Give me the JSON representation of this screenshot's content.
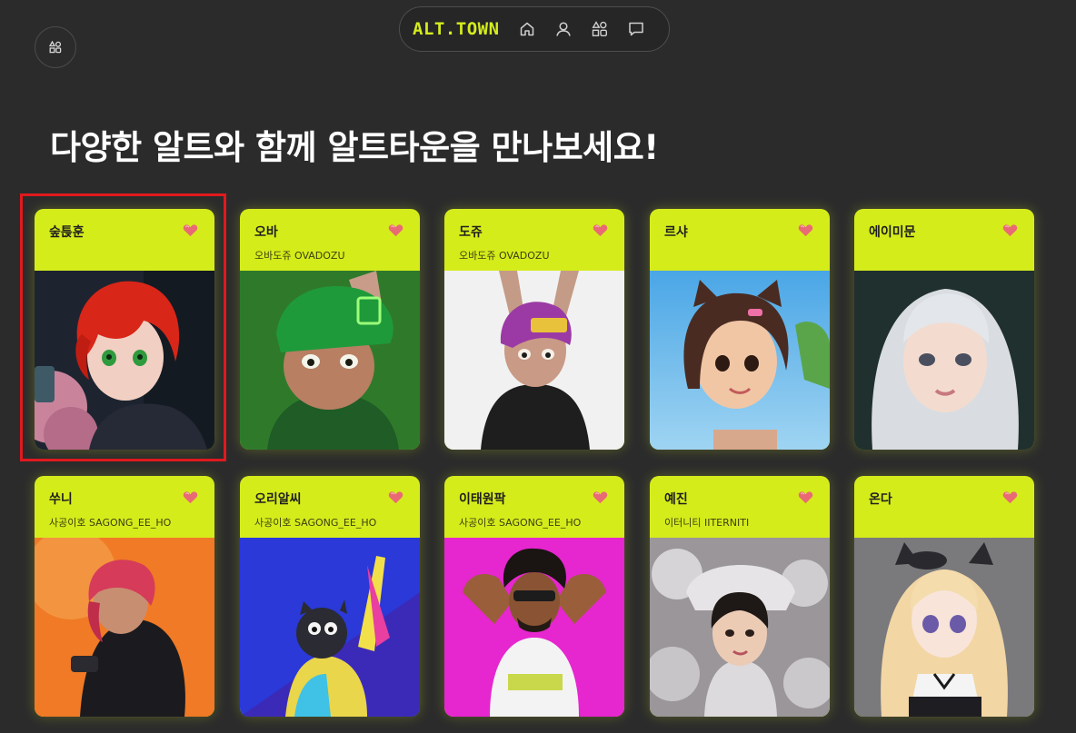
{
  "header": {
    "logo": "ALT.TOWN",
    "nav": [
      {
        "icon": "home-icon"
      },
      {
        "icon": "user-icon"
      },
      {
        "icon": "shapes-icon"
      },
      {
        "icon": "chat-icon"
      }
    ]
  },
  "corner_button": {
    "icon": "shapes-icon"
  },
  "headline": "다양한 알트와 함께 알트타운을 만나보세요!",
  "cards": [
    {
      "name": "숲튽훈",
      "creator": "",
      "icon": "heart-icon",
      "selected": true
    },
    {
      "name": "오바",
      "creator": "오바도쥬 OVADOZU",
      "icon": "heart-icon"
    },
    {
      "name": "도쥬",
      "creator": "오바도쥬 OVADOZU",
      "icon": "heart-icon"
    },
    {
      "name": "르샤",
      "creator": "",
      "icon": "heart-icon"
    },
    {
      "name": "에이미문",
      "creator": "",
      "icon": "heart-icon"
    },
    {
      "name": "쑤니",
      "creator": "사공이호 SAGONG_EE_HO",
      "icon": "heart-icon"
    },
    {
      "name": "오리알씨",
      "creator": "사공이호 SAGONG_EE_HO",
      "icon": "heart-icon"
    },
    {
      "name": "이태원팍",
      "creator": "사공이호 SAGONG_EE_HO",
      "icon": "heart-icon"
    },
    {
      "name": "예진",
      "creator": "이터니티 IITERNITI",
      "icon": "heart-icon"
    },
    {
      "name": "온다",
      "creator": "",
      "icon": "heart-icon"
    }
  ],
  "colors": {
    "background": "#2b2b2c",
    "accent": "#d5ec1b",
    "heart": "#e96a74",
    "selection": "#e0191e"
  }
}
